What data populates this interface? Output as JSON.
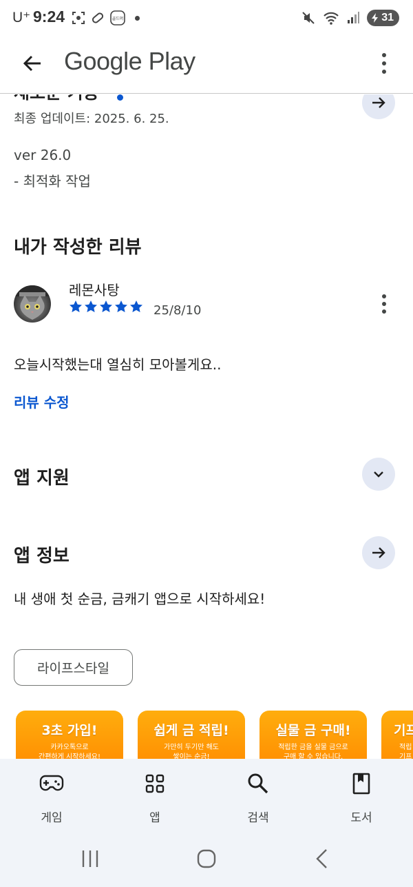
{
  "status_bar": {
    "carrier": "U⁺",
    "time": "9:24",
    "notification_badge": "골드머",
    "battery": "31"
  },
  "app_bar": {
    "title": "Google Play"
  },
  "whats_new": {
    "title": "새로운 기능",
    "updated": "최종 업데이트: 2025. 6. 25.",
    "notes": [
      "ver 26.0",
      "- 최적화 작업"
    ]
  },
  "my_review": {
    "section_title": "내가 작성한 리뷰",
    "reviewer_name": "레몬사탕",
    "rating": 5,
    "date": "25/8/10",
    "text": "오늘시작했는대 열심히 모아볼게요..",
    "edit_label": "리뷰 수정"
  },
  "app_support": {
    "title": "앱 지원"
  },
  "app_info": {
    "title": "앱 정보",
    "description": "내 생애 첫 순금, 금캐기 앱으로 시작하세요!",
    "category": "라이프스타일"
  },
  "screenshots": [
    {
      "title": "3초 가입!",
      "lines": [
        "카카오톡으로",
        "간편하게 시작하세요!"
      ]
    },
    {
      "title": "쉽게 금 적립!",
      "lines": [
        "가만히 두기만 해도",
        "쌓이는 순금!"
      ]
    },
    {
      "title": "실물 금 구매!",
      "lines": [
        "적립한 금을 실물 금으로",
        "구매 할 수 있습니다."
      ]
    },
    {
      "title": "기프",
      "lines": [
        "적립",
        "기프"
      ]
    }
  ],
  "bottom_nav": {
    "items": [
      {
        "label": "게임",
        "icon": "gamepad-icon"
      },
      {
        "label": "앱",
        "icon": "apps-grid-icon"
      },
      {
        "label": "검색",
        "icon": "search-icon"
      },
      {
        "label": "도서",
        "icon": "book-icon"
      }
    ]
  },
  "colors": {
    "accent": "#0b57d0",
    "star": "#0b57d0",
    "nav_background": "#f1f4f9",
    "round_button": "#e3e8f4",
    "screenshot_orange": "#ff9a00"
  }
}
